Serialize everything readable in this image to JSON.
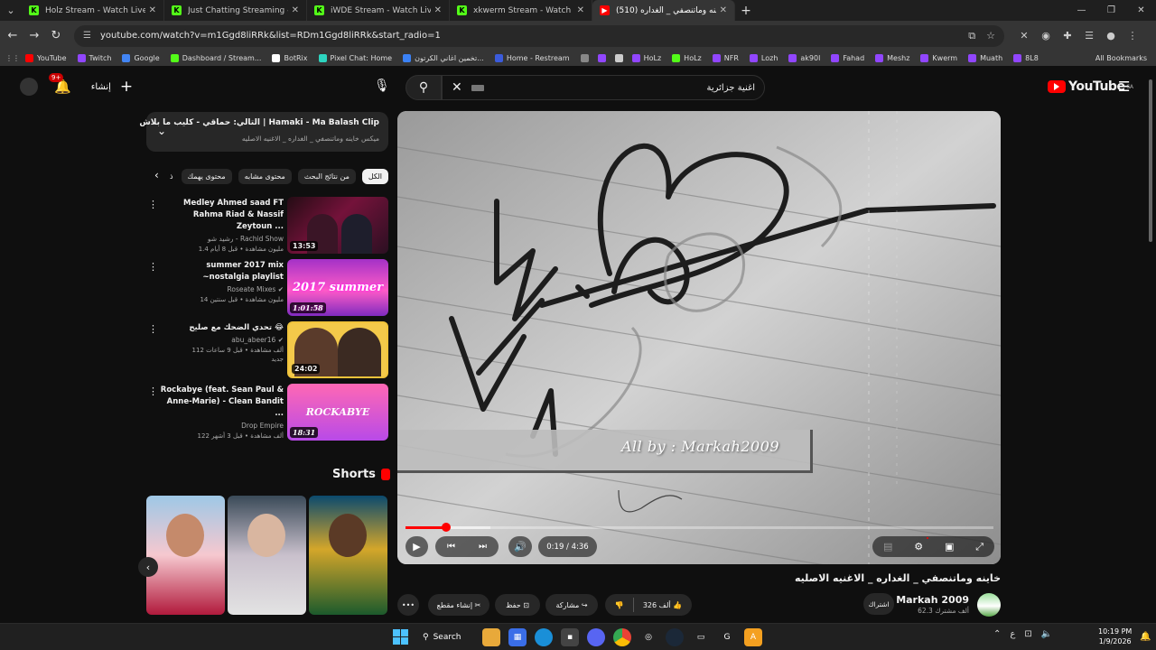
{
  "browser": {
    "tabs": [
      {
        "title": "Holz Stream - Watch Live on Kick",
        "favicon": "kick-icon",
        "active": false
      },
      {
        "title": "Just Chatting Streaming - Live St",
        "favicon": "kick-icon",
        "active": false
      },
      {
        "title": "iWDE Stream - Watch Live on Kick",
        "favicon": "kick-icon",
        "active": false
      },
      {
        "title": "xkwerm Stream - Watch Live on Kick",
        "favicon": "kick-icon",
        "active": false
      },
      {
        "title": "(510) خاينه وماتنصفي _ الغداره",
        "favicon": "youtube-icon",
        "active": true
      }
    ],
    "url": "youtube.com/watch?v=m1Ggd8liRRk&list=RDm1Ggd8liRRk&start_radio=1",
    "bookmarks": [
      {
        "label": "YouTube",
        "color": "#ff0000"
      },
      {
        "label": "Twitch",
        "color": "#9146ff"
      },
      {
        "label": "Google",
        "color": "#4285f4"
      },
      {
        "label": "Dashboard / Stream...",
        "color": "#53fc18"
      },
      {
        "label": "BotRix",
        "color": "#ffffff"
      },
      {
        "label": "Pixel Chat: Home",
        "color": "#2dd4bf"
      },
      {
        "label": "تخمين اغاني الكرتون...",
        "color": "#3b82f6"
      },
      {
        "label": "Home - Restream",
        "color": "#3b5bdb"
      },
      {
        "label": "",
        "color": "#888888"
      },
      {
        "label": "",
        "color": "#9146ff"
      },
      {
        "label": "",
        "color": "#cccccc"
      },
      {
        "label": "HoLz",
        "color": "#9146ff"
      },
      {
        "label": "HoLz",
        "color": "#53fc18"
      },
      {
        "label": "NFR",
        "color": "#9146ff"
      },
      {
        "label": "Lozh",
        "color": "#9146ff"
      },
      {
        "label": "ak90l",
        "color": "#9146ff"
      },
      {
        "label": "Fahad",
        "color": "#9146ff"
      },
      {
        "label": "Meshz",
        "color": "#9146ff"
      },
      {
        "label": "Kwerm",
        "color": "#9146ff"
      },
      {
        "label": "Muath",
        "color": "#9146ff"
      },
      {
        "label": "8L8",
        "color": "#9146ff"
      }
    ],
    "all_bookmarks": "All Bookmarks"
  },
  "masthead": {
    "notif_badge": "9+",
    "create_label": "إنشاء",
    "search_query": "اغنية جزائرية",
    "logo_text": "YouTube",
    "logo_region": "SA"
  },
  "queue": {
    "next": "التالي: حماقي - كليب ما بلاش | Hamaki - Ma Balash Clip",
    "sub": "ميكس خاينه وماتنصفي _ الغداره _ الاغنيه الاصليه"
  },
  "chips": [
    "الكل",
    "من نتائج البحث",
    "محتوى مشابه",
    "محتوى يهمك",
    "ذ"
  ],
  "related": [
    {
      "title": "Medley Ahmed saad FT Rahma Riad & Nassif Zeytoun ...",
      "channel": "رشيد شو - Rachid Show",
      "meta": "1.4 مليون مشاهدة • قبل 8 أيام",
      "duration": "13:53"
    },
    {
      "title": "summer 2017 mix ~nostalgia playlist",
      "channel": "Roseate Mixes",
      "meta": "14 مليون مشاهدة • قبل سنتين",
      "duration": "1:01:58",
      "thumb_text": "2017 summer"
    },
    {
      "title": "تحدي الضحك مع صليح 😂",
      "channel": "abu_abeer16",
      "meta": "112 ألف مشاهدة • قبل 9 ساعات",
      "meta2": "جديد",
      "duration": "24:02"
    },
    {
      "title": "Rockabye (feat. Sean Paul & Anne-Marie) - Clean Bandit ...",
      "channel": "Drop Empire",
      "meta": "122 ألف مشاهدة • قبل 3 أشهر",
      "duration": "18:31",
      "thumb_text": "ROCKABYE"
    }
  ],
  "shorts": {
    "title": "Shorts"
  },
  "player": {
    "credit": "All by : Markah2009",
    "time": "0:19 / 4:36",
    "progress_fraction": 0.069
  },
  "video": {
    "title": "خاينه وماتنصفي _ الغداره _ الاغنيه الاصليه",
    "channel": "Markah 2009",
    "subs": "62.3 ألف مشترك",
    "subscribe": "اشتراك",
    "likes": "326 ألف",
    "share": "مشاركة",
    "save": "حفظ",
    "clip": "إنشاء مقطع"
  },
  "taskbar": {
    "search": "Search",
    "lang": "ع",
    "time": "10:19 PM",
    "date": "1/9/2026"
  }
}
